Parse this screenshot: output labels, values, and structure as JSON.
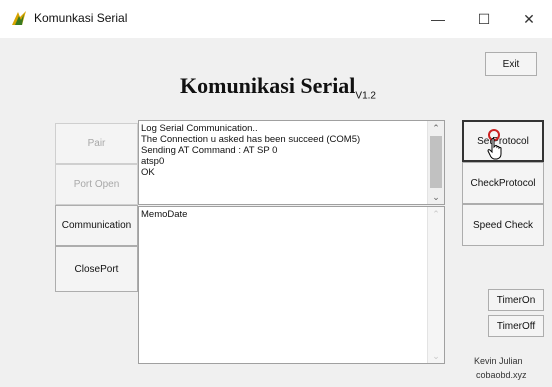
{
  "window": {
    "title": "Komunkasi Serial",
    "minimize_glyph": "—",
    "maximize_glyph": "☐",
    "close_glyph": "✕"
  },
  "icons": {
    "app": "app-logo-icon",
    "cursor": "hand-pointer-icon",
    "focus": "red-circle-indicator"
  },
  "header": {
    "exit_label": "Exit",
    "title": "Komunikasi Serial",
    "version": "V1.2"
  },
  "left_buttons": {
    "pair": "Pair",
    "port_open": "Port Open",
    "communication": "Communication",
    "close_port": "ClosePort"
  },
  "log": {
    "lines": [
      "Log Serial Communication..",
      "The Connection u asked has been succeed (COM5)",
      "Sending AT Command : AT SP 0",
      "atsp0",
      "OK"
    ]
  },
  "memo2": {
    "text": "MemoDate"
  },
  "right_buttons": {
    "set_protocol": "SetProtocol",
    "check_protocol": "CheckProtocol",
    "speed_check": "Speed Check",
    "timer_on": "TimerOn",
    "timer_off": "TimerOff"
  },
  "credit": {
    "name": "Kevin Julian",
    "site": "cobaobd.xyz"
  },
  "scroll": {
    "up": "⌃",
    "down": "⌄"
  },
  "colors": {
    "accent_red": "#cc2222",
    "disabled_text": "#a8a8a8"
  }
}
